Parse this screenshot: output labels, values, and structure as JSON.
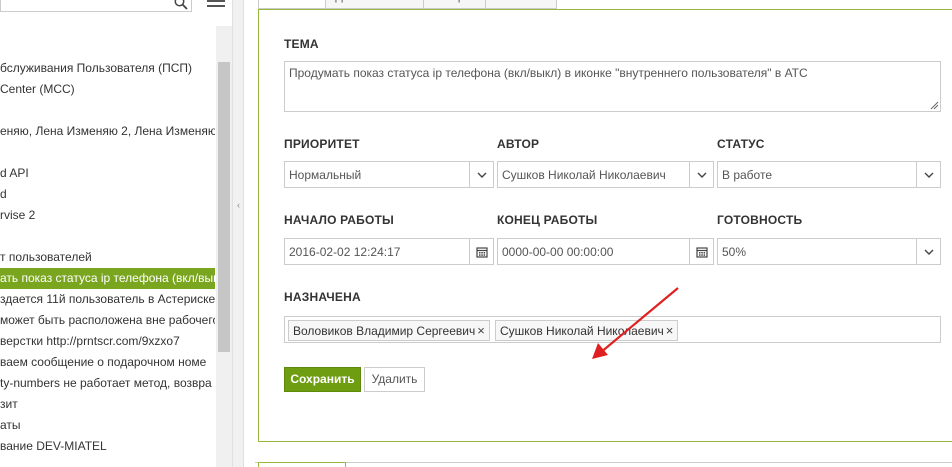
{
  "sidebar": {
    "search_placeholder": "",
    "items": [
      {
        "label": "бслуживания Пользователя (ПСП)"
      },
      {
        "label": "Center (MCC)"
      },
      {
        "label": ""
      },
      {
        "label": "еняю, Лена Изменяю 2, Лена Изменяю"
      },
      {
        "label": ""
      },
      {
        "label": "d API"
      },
      {
        "label": "d"
      },
      {
        "label": "rvise 2"
      },
      {
        "label": ""
      },
      {
        "label": "т пользователей"
      },
      {
        "label": "ать показ статуса ip телефона (вкл/вык"
      },
      {
        "label": "здается 11й пользователь в Астериске"
      },
      {
        "label": "может быть расположена вне рабочего"
      },
      {
        "label": "верстки http://prntscr.com/9xzxo7"
      },
      {
        "label": "ваем сообщение о подарочном номе"
      },
      {
        "label": "ty-numbers не работает метод, возвра"
      },
      {
        "label": "зит"
      },
      {
        "label": "аты"
      },
      {
        "label": "вание DEV-MIATEL"
      }
    ]
  },
  "tabs": [
    {
      "label": "Свойства"
    },
    {
      "label": "Дополнительно"
    },
    {
      "label": "История"
    },
    {
      "label": "Вложения"
    }
  ],
  "form": {
    "subject_label": "ТЕМА",
    "subject_value": "Продумать показ статуса ip телефона (вкл/выкл)   в иконке \"внутреннего пользователя\"  в АТС",
    "priority_label": "ПРИОРИТЕТ",
    "priority_value": "Нормальный",
    "author_label": "АВТОР",
    "author_value": "Сушков Николай Николаевич",
    "status_label": "СТАТУС",
    "status_value": "В работе",
    "start_label": "НАЧАЛО РАБОТЫ",
    "start_value": "2016-02-02 12:24:17",
    "end_label": "КОНЕЦ РАБОТЫ",
    "end_value": "0000-00-00 00:00:00",
    "progress_label": "ГОТОВНОСТЬ",
    "progress_value": "50%",
    "assigned_label": "НАЗНАЧЕНА",
    "assignees": [
      {
        "name": "Воловиков Владимир Сергеевич"
      },
      {
        "name": "Сушков Николай Николаевич"
      }
    ],
    "save_label": "Сохранить",
    "delete_label": "Удалить"
  },
  "colors": {
    "accent": "#6f9d12",
    "selected_item": "#7aa61f",
    "panel_border": "#96b83c",
    "annotation_arrow": "#e02020"
  },
  "icons": {
    "search": "search-icon",
    "menu": "hamburger-menu-icon",
    "dropdown": "chevron-down-icon",
    "calendar": "calendar-icon",
    "remove": "close-icon"
  }
}
